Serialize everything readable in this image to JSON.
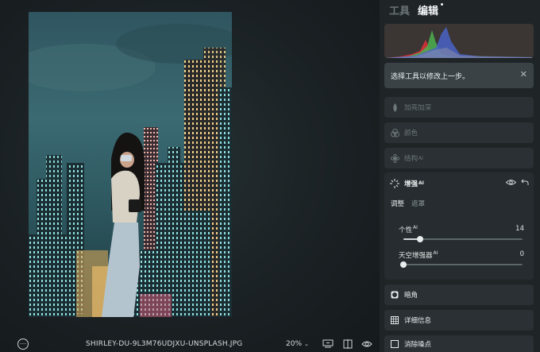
{
  "panel": {
    "tabs": [
      {
        "label": "工具"
      },
      {
        "label": "编辑"
      }
    ],
    "hint": {
      "text": "选择工具以修改上一步。"
    },
    "tools": [
      {
        "label": "加亮加深",
        "icon": "drop-icon"
      },
      {
        "label": "颜色",
        "icon": "color-circles-icon"
      },
      {
        "label": "结构",
        "ai": "AI",
        "icon": "structure-flower-icon"
      }
    ],
    "enhance": {
      "label": "增强",
      "ai": "AI",
      "subtabs": [
        {
          "label": "调整"
        },
        {
          "label": "遮罩"
        }
      ],
      "sliders": [
        {
          "label": "个性",
          "ai": "AI",
          "value": "14",
          "fraction": 0.14
        },
        {
          "label": "天空增强器",
          "ai": "AI",
          "value": "0",
          "fraction": 0.0
        }
      ]
    },
    "lower_tools": [
      {
        "label": "暗角",
        "icon": "vignette-icon"
      },
      {
        "label": "详细信息",
        "icon": "detail-grid-icon"
      },
      {
        "label": "消除噪点",
        "icon": "denoise-icon"
      }
    ]
  },
  "bottom_bar": {
    "filename": "SHIRLEY-DU-9L3M76UDJXU-UNSPLASH.JPG",
    "zoom": "20%"
  },
  "colors": {
    "panel_bg": "#1f2527",
    "accent_text": "#f2f4f5",
    "histogram_red": "#d8303a",
    "histogram_green": "#4bb04f",
    "histogram_blue": "#4a63c8"
  }
}
